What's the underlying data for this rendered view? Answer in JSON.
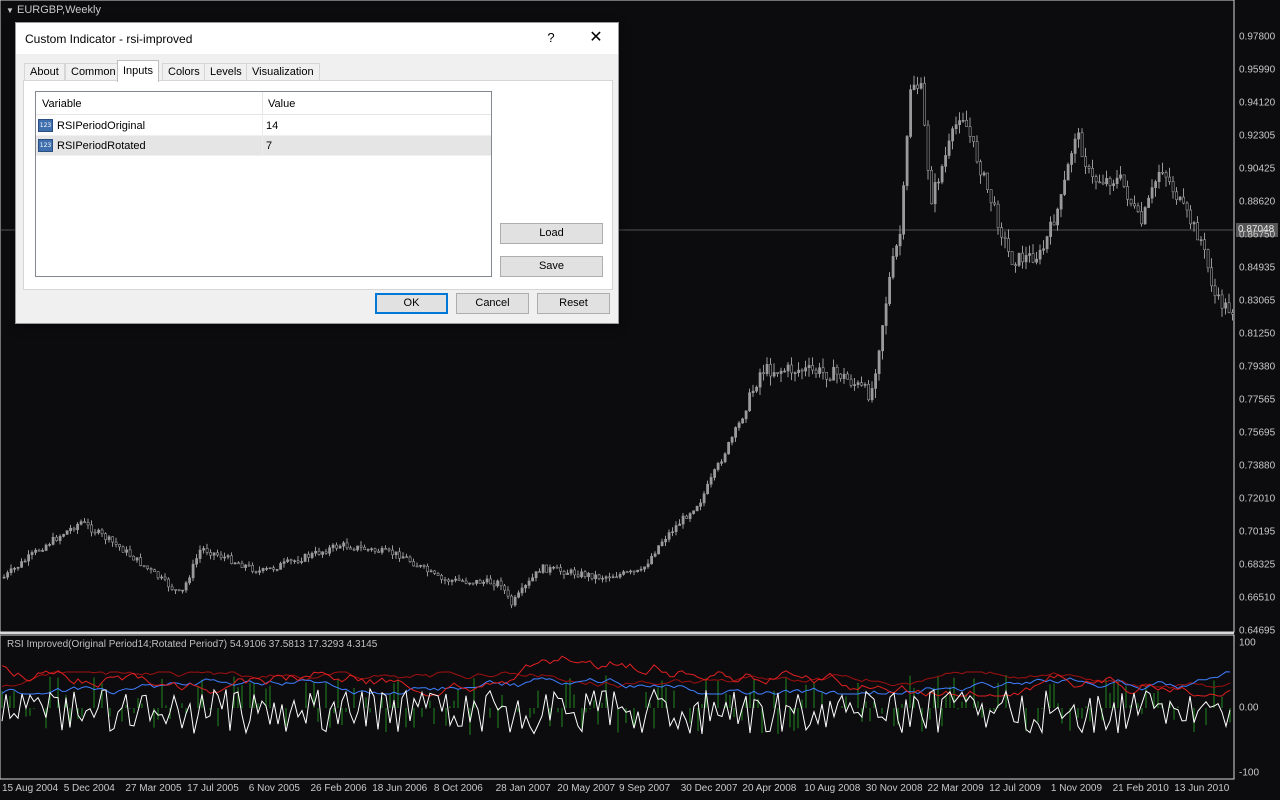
{
  "chart": {
    "symbol": "EURGBP,Weekly",
    "current_price": "0.87048",
    "price_ticks": [
      "0.97800",
      "0.95990",
      "0.94120",
      "0.92305",
      "0.90425",
      "0.88620",
      "0.86750",
      "0.84935",
      "0.83065",
      "0.81250",
      "0.79380",
      "0.77565",
      "0.75695",
      "0.73880",
      "0.72010",
      "0.70195",
      "0.68325",
      "0.66510",
      "0.64695"
    ],
    "time_ticks": [
      "15 Aug 2004",
      "5 Dec 2004",
      "27 Mar 2005",
      "17 Jul 2005",
      "6 Nov 2005",
      "26 Feb 2006",
      "18 Jun 2006",
      "8 Oct 2006",
      "28 Jan 2007",
      "20 May 2007",
      "9 Sep 2007",
      "30 Dec 2007",
      "20 Apr 2008",
      "10 Aug 2008",
      "30 Nov 2008",
      "22 Mar 2009",
      "12 Jul 2009",
      "1 Nov 2009",
      "21 Feb 2010",
      "13 Jun 2010"
    ],
    "colors": {
      "background": "#0c0c0f",
      "candle": "#9a9a9a",
      "grid": "#d9d9d9"
    }
  },
  "indicator_window": {
    "label": "RSI Improved(Original Period14;Rotated Period7) 54.9106 37.5813 17.3293 4.3145",
    "levels": [
      "100",
      "0.00",
      "-100"
    ],
    "colors": {
      "blue": "#3f7fff",
      "red": "#e02020",
      "white": "#ffffff",
      "green": "#1f8a1f",
      "darkred": "#a01010"
    }
  },
  "dialog": {
    "title": "Custom Indicator - rsi-improved",
    "help": "?",
    "close": "✕",
    "tabs": [
      "About",
      "Common",
      "Inputs",
      "Colors",
      "Levels",
      "Visualization"
    ],
    "active_tab": "Inputs",
    "table": {
      "headers": [
        "Variable",
        "Value"
      ],
      "rows": [
        {
          "icon": "123",
          "name": "RSIPeriodOriginal",
          "value": "14"
        },
        {
          "icon": "123",
          "name": "RSIPeriodRotated",
          "value": "7"
        }
      ]
    },
    "load_label": "Load",
    "save_label": "Save",
    "ok_label": "OK",
    "cancel_label": "Cancel",
    "reset_label": "Reset"
  }
}
